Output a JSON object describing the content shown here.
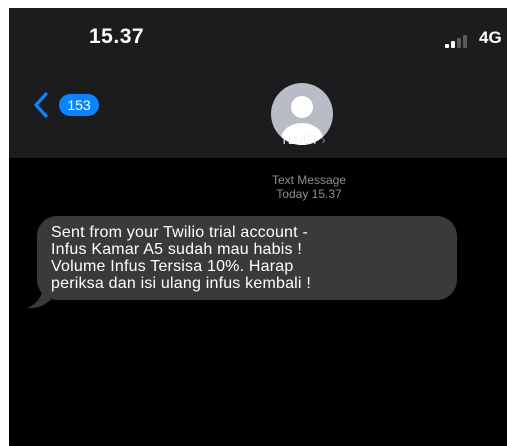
{
  "status_bar": {
    "time": "15.37",
    "network": "4G"
  },
  "nav": {
    "unread_count": "153",
    "contact_name": "TLNET",
    "contact_chevron": "›"
  },
  "conversation": {
    "message_type": "Text Message",
    "timestamp": "Today 15.37",
    "messages": [
      {
        "text": "Sent from your Twilio trial account -\nInfus Kamar A5 sudah mau habis !\nVolume Infus Tersisa 10%. Harap\nperiksa dan isi ulang infus kembali !"
      }
    ]
  },
  "icons": {
    "back": "chevron-left-icon",
    "signal": "signal-strength-icon",
    "avatar": "person-avatar-icon"
  },
  "colors": {
    "background": "#000000",
    "header": "#1c1c1e",
    "accent": "#0a84ff",
    "bubble": "#3a3a3c",
    "meta_text": "#8e8e93"
  }
}
